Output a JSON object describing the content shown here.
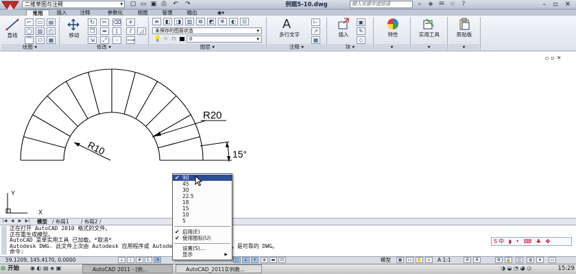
{
  "title_bar": {
    "workspace": "二维草图与注释",
    "document_title": "例题5-10.dwg",
    "search_placeholder": "键入关键字或短语"
  },
  "ribbon_tabs": [
    "常用",
    "插入",
    "注释",
    "参数化",
    "视图",
    "管理",
    "输出"
  ],
  "ribbon": {
    "draw": {
      "label": "绘图",
      "line_label": "直线"
    },
    "modify": {
      "label": "修改",
      "move_label": "移动"
    },
    "layers": {
      "label": "图层",
      "layer_state": "未保存的图层状态",
      "current_layer": "0"
    },
    "annotation": {
      "label": "注释",
      "mtext_label": "多行文字"
    },
    "block": {
      "label": "块",
      "insert_label": "插入"
    },
    "properties": {
      "label": "特性"
    },
    "utilities": {
      "label": "实用工具"
    },
    "clipboard": {
      "label": "剪贴板"
    }
  },
  "drawing": {
    "dim_outer": "R20",
    "dim_inner": "R10",
    "dim_angle": "15°",
    "ucs_y": "Y",
    "ucs_x": "X"
  },
  "layout_tabs": [
    "模型",
    "布局1",
    "布局2"
  ],
  "command_lines": [
    "正在打开 AutoCAD 2010 格式的文件。",
    "正在重生成模型。",
    "AutoCAD 菜单实用工具 已加载。*取消*",
    "Autodesk DWG.   此文件上次由 Autodesk 应用程序或 Autodesk 许可的应用程序保存，是可靠的 DWG。",
    "命令:"
  ],
  "status_bar": {
    "coordinates": "59.1209,  145.4170,  0.0000",
    "model_label": "模型",
    "annotation_scale": "A 1:1"
  },
  "popup_menu": {
    "angles": [
      "90",
      "45",
      "30",
      "22.5",
      "18",
      "15",
      "10",
      "5"
    ],
    "selected": "90",
    "enable": "启用(E)",
    "use_icons": "使用图标(U)",
    "settings": "设置(S)...",
    "display": "显示"
  },
  "taskbar": {
    "start": "开始",
    "task1": "AutoCAD 2011 - [例...",
    "task2": "AutoCAD_2011实例教...",
    "clock": "15:29"
  },
  "colors": {
    "menu_highlight": "#2d4e96",
    "ribbon_bg": "#e6ebf2",
    "logo_red": "#c62828"
  }
}
